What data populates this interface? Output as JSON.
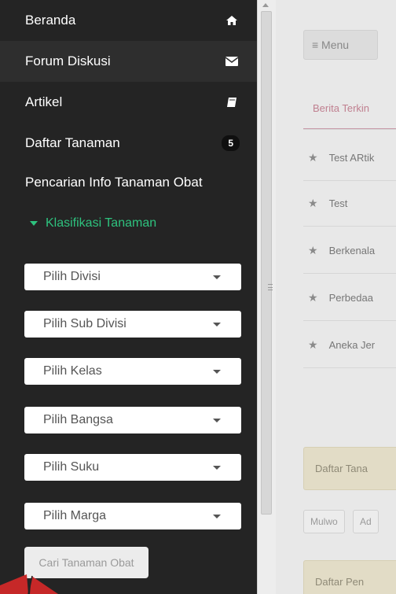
{
  "sidebar": {
    "items": [
      {
        "label": "Beranda",
        "icon": "home-icon"
      },
      {
        "label": "Forum Diskusi",
        "icon": "envelope-icon"
      },
      {
        "label": "Artikel",
        "icon": "book-icon"
      },
      {
        "label": "Daftar Tanaman",
        "badge": "5"
      }
    ],
    "search_title": "Pencarian Info Tanaman Obat",
    "klasifikasi_label": "Klasifikasi Tanaman",
    "selects": [
      "Pilih Divisi",
      "Pilih Sub Divisi",
      "Pilih Kelas",
      "Pilih Bangsa",
      "Pilih Suku",
      "Pilih Marga"
    ],
    "search_button": "Cari Tanaman Obat"
  },
  "main": {
    "menu_button": "≡ Menu",
    "active_tab": "Berita Terkin",
    "news": [
      "Test ARtik",
      "Test",
      "Berkenala",
      "Perbedaa",
      "Aneka Jer"
    ],
    "panel1": "Daftar Tana",
    "chips": [
      "Mulwo",
      "Ad"
    ],
    "panel2": "Daftar Pen"
  },
  "colors": {
    "sidebar_bg": "#242424",
    "accent_green": "#2ec27e",
    "tab_accent": "#c08090"
  }
}
